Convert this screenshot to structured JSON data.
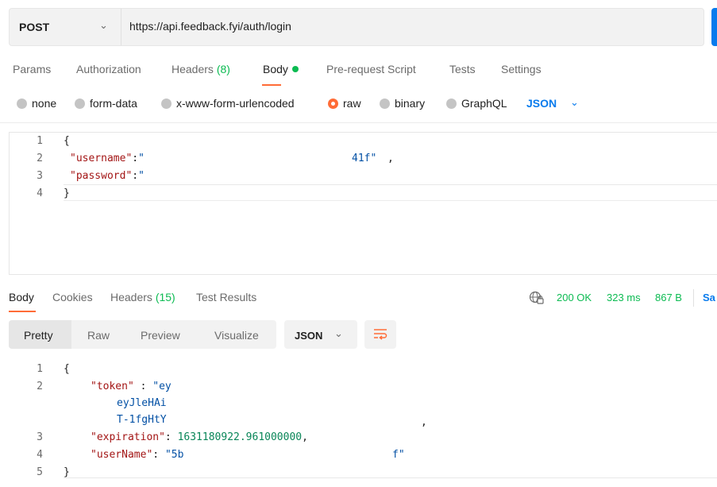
{
  "request": {
    "method": "POST",
    "url": "https://api.feedback.fyi/auth/login"
  },
  "request_tabs": [
    {
      "label": "Params"
    },
    {
      "label": "Authorization"
    },
    {
      "label": "Headers",
      "count": "(8)"
    },
    {
      "label": "Body"
    },
    {
      "label": "Pre-request Script"
    },
    {
      "label": "Tests"
    },
    {
      "label": "Settings"
    }
  ],
  "body_types": [
    {
      "label": "none",
      "selected": false
    },
    {
      "label": "form-data",
      "selected": false
    },
    {
      "label": "x-www-form-urlencoded",
      "selected": false
    },
    {
      "label": "raw",
      "selected": true
    },
    {
      "label": "binary",
      "selected": false
    },
    {
      "label": "GraphQL",
      "selected": false
    }
  ],
  "body_format": "JSON",
  "request_body": {
    "line_numbers": [
      "1",
      "2",
      "3",
      "4"
    ],
    "open_brace": "{",
    "username_key": "\"username\"",
    "colon": ":",
    "username_value_start": "\"",
    "username_value_end": "41f\"",
    "comma": ",",
    "password_key": "\"password\"",
    "password_value_start": "\"",
    "close_brace": "}"
  },
  "response_tabs": [
    {
      "label": "Body"
    },
    {
      "label": "Cookies"
    },
    {
      "label": "Headers",
      "count": "(15)"
    },
    {
      "label": "Test Results"
    }
  ],
  "response_status": {
    "status": "200 OK",
    "time": "323 ms",
    "size": "867 B",
    "save_label": "Sa"
  },
  "view_modes": [
    "Pretty",
    "Raw",
    "Preview",
    "Visualize"
  ],
  "response_format": "JSON",
  "response_body": {
    "line_numbers": [
      "1",
      "2",
      "3",
      "4",
      "5"
    ],
    "open_brace": "{",
    "token_key": "\"token\"",
    "token_line1": "\"ey",
    "token_line2": "eyJleHAi",
    "token_line3": "T-1fgHtY",
    "comma": ",",
    "expiration_key": "\"expiration\"",
    "expiration_value": "1631180922.961000000",
    "username_key": "\"userName\"",
    "username_value_start": "\"5b",
    "username_value_end": "f\"",
    "close_brace": "}"
  },
  "colors": {
    "accent": "#ff6c37",
    "success": "#0cbb52",
    "link": "#097bed"
  }
}
